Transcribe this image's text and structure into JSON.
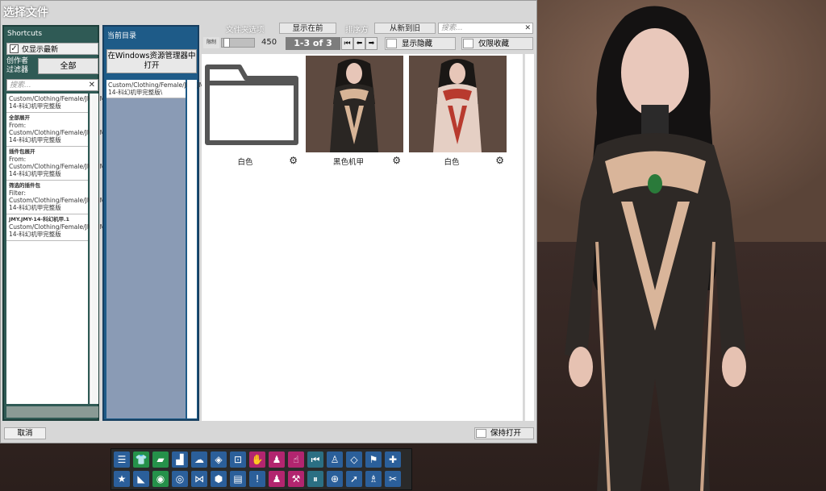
{
  "dialog": {
    "title": "选择文件"
  },
  "shortcuts": {
    "header": "Shortcuts",
    "latest_only_label": "仅显示最新",
    "latest_only_checked": true,
    "creator_filter_label": "创作者\n过滤器",
    "all_button": "全部",
    "search_placeholder": "搜索...",
    "items": [
      {
        "heading": "",
        "text": "Custom/Clothing/Female/JMY/JMY-14-科幻机甲完整版"
      },
      {
        "heading": "全部展开",
        "text": "From: Custom/Clothing/Female/JMY/JMY-14-科幻机甲完整版"
      },
      {
        "heading": "插件包展开",
        "text": "From: Custom/Clothing/Female/JMY/JMY-14-科幻机甲完整版"
      },
      {
        "heading": "筛选的插件包",
        "text": "Filter: Custom/Clothing/Female/JMY/JMY-14-科幻机甲完整版"
      },
      {
        "heading": "JMY.JMY-14-科幻机甲.1",
        "text": "Custom/Clothing/Female/JMY/JMY-14-科幻机甲完整版"
      }
    ]
  },
  "current_dir": {
    "header": "当前目录",
    "open_explorer_button": "在Windows资源管理器中打开",
    "path": "Custom/Clothing/Female/JMY/JMY-14-科幻机甲完整版\\"
  },
  "toolbar": {
    "folder_options_label": "文件夹选项",
    "show_first_button": "显示在前",
    "sort_label": "排序方",
    "sort_value": "从新到旧",
    "search_placeholder": "搜索...",
    "size_label": "限制",
    "size_value": "450",
    "page_indicator": "1-3 of 3",
    "show_hidden_label": "显示隐藏",
    "favorites_only_label": "仅限收藏"
  },
  "files": [
    {
      "name": "白色",
      "kind": "folder"
    },
    {
      "name": "黑色机甲",
      "kind": "image",
      "accent": "#2a2a2a"
    },
    {
      "name": "白色",
      "kind": "image",
      "accent": "#e8d2c8"
    }
  ],
  "footer": {
    "cancel_button": "取消",
    "keep_open_label": "保持打开"
  },
  "colors": {
    "shortcuts_panel": "#2f5a55",
    "current_dir_panel": "#1e5b88",
    "dialog_bg": "#d7d7d7"
  },
  "icon_toolbar": {
    "row1": [
      "menu-icon",
      "clothing-icon",
      "folder-icon",
      "paint-icon",
      "cloud-upload-icon",
      "box-icon",
      "inbox-icon",
      "hand-icon",
      "person-edit-icon",
      "pointer-icon",
      "skip-back-icon",
      "person-icon",
      "unity-icon",
      "flag-icon",
      "plus-icon"
    ],
    "row2": [
      "star-icon",
      "iron-icon",
      "camera-green-icon",
      "camera-icon",
      "graph-icon",
      "cube-icon",
      "document-icon",
      "alert-icon",
      "person-settings-icon",
      "wrench-icon",
      "pause-icon",
      "target-icon",
      "cursor-icon",
      "people-icon",
      "tools-icon"
    ]
  }
}
